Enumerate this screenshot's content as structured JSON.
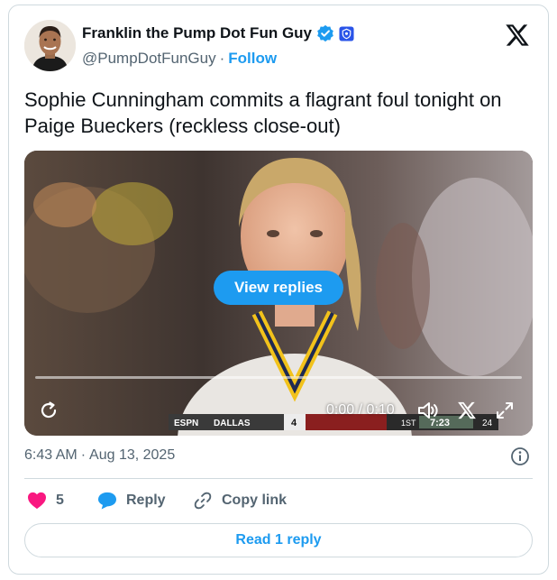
{
  "author": {
    "display_name": "Franklin the Pump Dot Fun Guy",
    "handle": "@PumpDotFunGuy",
    "separator": "·",
    "follow_label": "Follow",
    "verified_color": "#1d9bf0",
    "affiliate_badge_color": "#2a54e8"
  },
  "tweet": {
    "text": "Sophie Cunningham commits a flagrant foul tonight on Paige Bueckers (reckless close-out)"
  },
  "video": {
    "overlay_button": "View replies",
    "time_display": "0:00 / 0:10",
    "progress_percent": 0,
    "scoreboard": {
      "network": "ESPN",
      "team": "DALLAS",
      "score": "4",
      "period": "1ST",
      "clock": "7:23",
      "shot_clock": "24"
    }
  },
  "meta": {
    "time": "6:43 AM",
    "separator": "·",
    "date": "Aug 13, 2025"
  },
  "actions": {
    "like_count": "5",
    "reply_label": "Reply",
    "copy_label": "Copy link"
  },
  "read_reply_label": "Read 1 reply",
  "colors": {
    "accent": "#1d9bf0",
    "like": "#f91880",
    "secondary_text": "#536471",
    "border": "#cfd9de"
  }
}
